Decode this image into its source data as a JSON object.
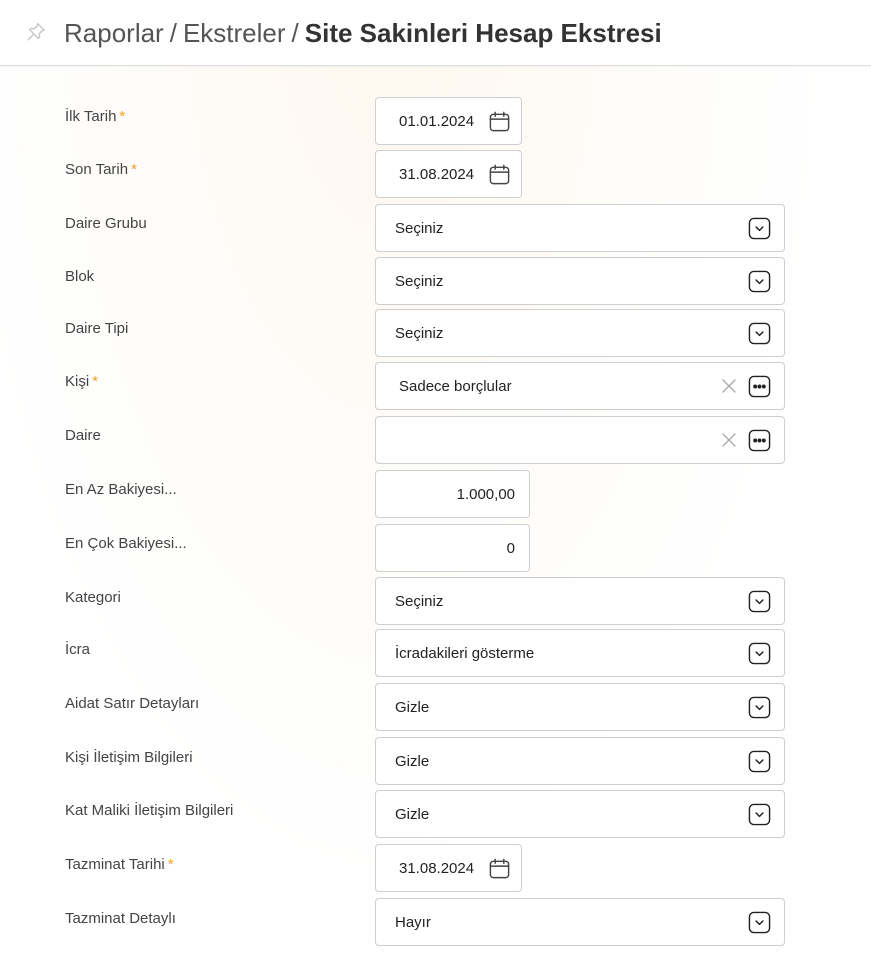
{
  "header": {
    "breadcrumb": [
      "Raporlar",
      "Ekstreler"
    ],
    "separator": "/",
    "title": "Site Sakinleri Hesap Ekstresi",
    "pin_icon": "pin-icon"
  },
  "required_marker": "*",
  "fields": {
    "ilk_tarih": {
      "label": "İlk Tarih",
      "value": "01.01.2024"
    },
    "son_tarih": {
      "label": "Son Tarih",
      "value": "31.08.2024"
    },
    "daire_grubu": {
      "label": "Daire Grubu",
      "value": "Seçiniz"
    },
    "blok": {
      "label": "Blok",
      "value": "Seçiniz"
    },
    "daire_tipi": {
      "label": "Daire Tipi",
      "value": "Seçiniz"
    },
    "kisi": {
      "label": "Kişi",
      "value": "Sadece borçlular"
    },
    "daire": {
      "label": "Daire",
      "value": ""
    },
    "en_az_bakiye": {
      "label": "En Az Bakiyesi...",
      "value": "1.000,00"
    },
    "en_cok_bakiye": {
      "label": "En Çok Bakiyesi...",
      "value": "0"
    },
    "kategori": {
      "label": "Kategori",
      "value": "Seçiniz"
    },
    "icra": {
      "label": "İcra",
      "value": "İcradakileri gösterme"
    },
    "aidat_satir_detaylari": {
      "label": "Aidat Satır Detayları",
      "value": "Gizle"
    },
    "kisi_iletisim_bilgileri": {
      "label": "Kişi İletişim Bilgileri",
      "value": "Gizle"
    },
    "kat_maliki_iletisim_bilgileri": {
      "label": "Kat Maliki İletişim Bilgileri",
      "value": "Gizle"
    },
    "tazminat_tarihi": {
      "label": "Tazminat Tarihi",
      "value": "31.08.2024"
    },
    "tazminat_detayli": {
      "label": "Tazminat Detaylı",
      "value": "Hayır"
    }
  },
  "colors": {
    "required": "#f0a020",
    "border": "#cfcfcf",
    "text": "#333333"
  }
}
